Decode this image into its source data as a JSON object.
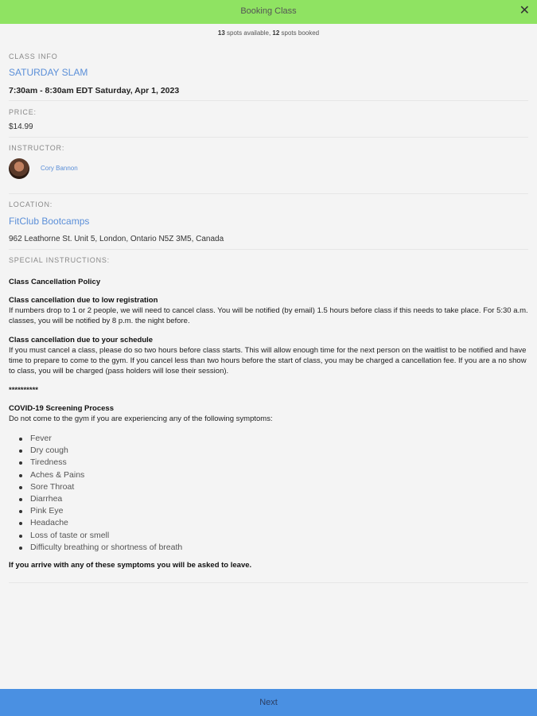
{
  "header": {
    "title": "Booking Class",
    "close_glyph": "✕"
  },
  "spots": {
    "available": "13",
    "available_text": " spots available, ",
    "booked": "12",
    "booked_text": " spots booked"
  },
  "class_info": {
    "label": "CLASS INFO",
    "name": "SATURDAY SLAM",
    "time": "7:30am - 8:30am EDT Saturday, Apr 1, 2023"
  },
  "price": {
    "label": "PRICE:",
    "value": "$14.99"
  },
  "instructor": {
    "label": "INSTRUCTOR:",
    "name": "Cory Bannon"
  },
  "location": {
    "label": "LOCATION:",
    "name": "FitClub Bootcamps",
    "address": "962 Leathorne St. Unit 5, London, Ontario N5Z 3M5, Canada"
  },
  "special": {
    "label": "SPECIAL INSTRUCTIONS:",
    "policy_title": "Class Cancellation Policy",
    "low_reg_title": "Class cancellation due to low registration",
    "low_reg_text": "If numbers drop to 1 or 2 people, we will need to cancel class. You will be notified (by email) 1.5 hours before class if this needs to take place. For 5:30 a.m. classes, you will be notified by 8 p.m. the night before.",
    "schedule_title": "Class cancellation due to your schedule",
    "schedule_text": "If you must cancel a class, please do so two hours before class starts. This will allow enough time for the next person on the waitlist to be notified and have time to prepare to come to the gym. If you cancel less than two hours before the start of class, you may be charged a cancellation fee. If you are a no show to class, you will be charged (pass holders will lose their session).",
    "stars": "**********",
    "covid_title": "COVID-19 Screening Process",
    "covid_intro": "Do not come to the gym if you are experiencing any of the following symptoms:",
    "symptoms": [
      "Fever",
      "Dry cough",
      "Tiredness",
      "Aches & Pains",
      "Sore Throat",
      "Diarrhea",
      "Pink Eye",
      "Headache",
      "Loss of taste or smell",
      "Difficulty breathing or shortness of breath"
    ],
    "warning": "If you arrive with any of these symptoms you will be asked to leave."
  },
  "footer": {
    "next_label": "Next"
  },
  "colors": {
    "header_bg": "#8fe362",
    "link": "#5b8fd8",
    "footer_bg": "#4a90e2"
  }
}
